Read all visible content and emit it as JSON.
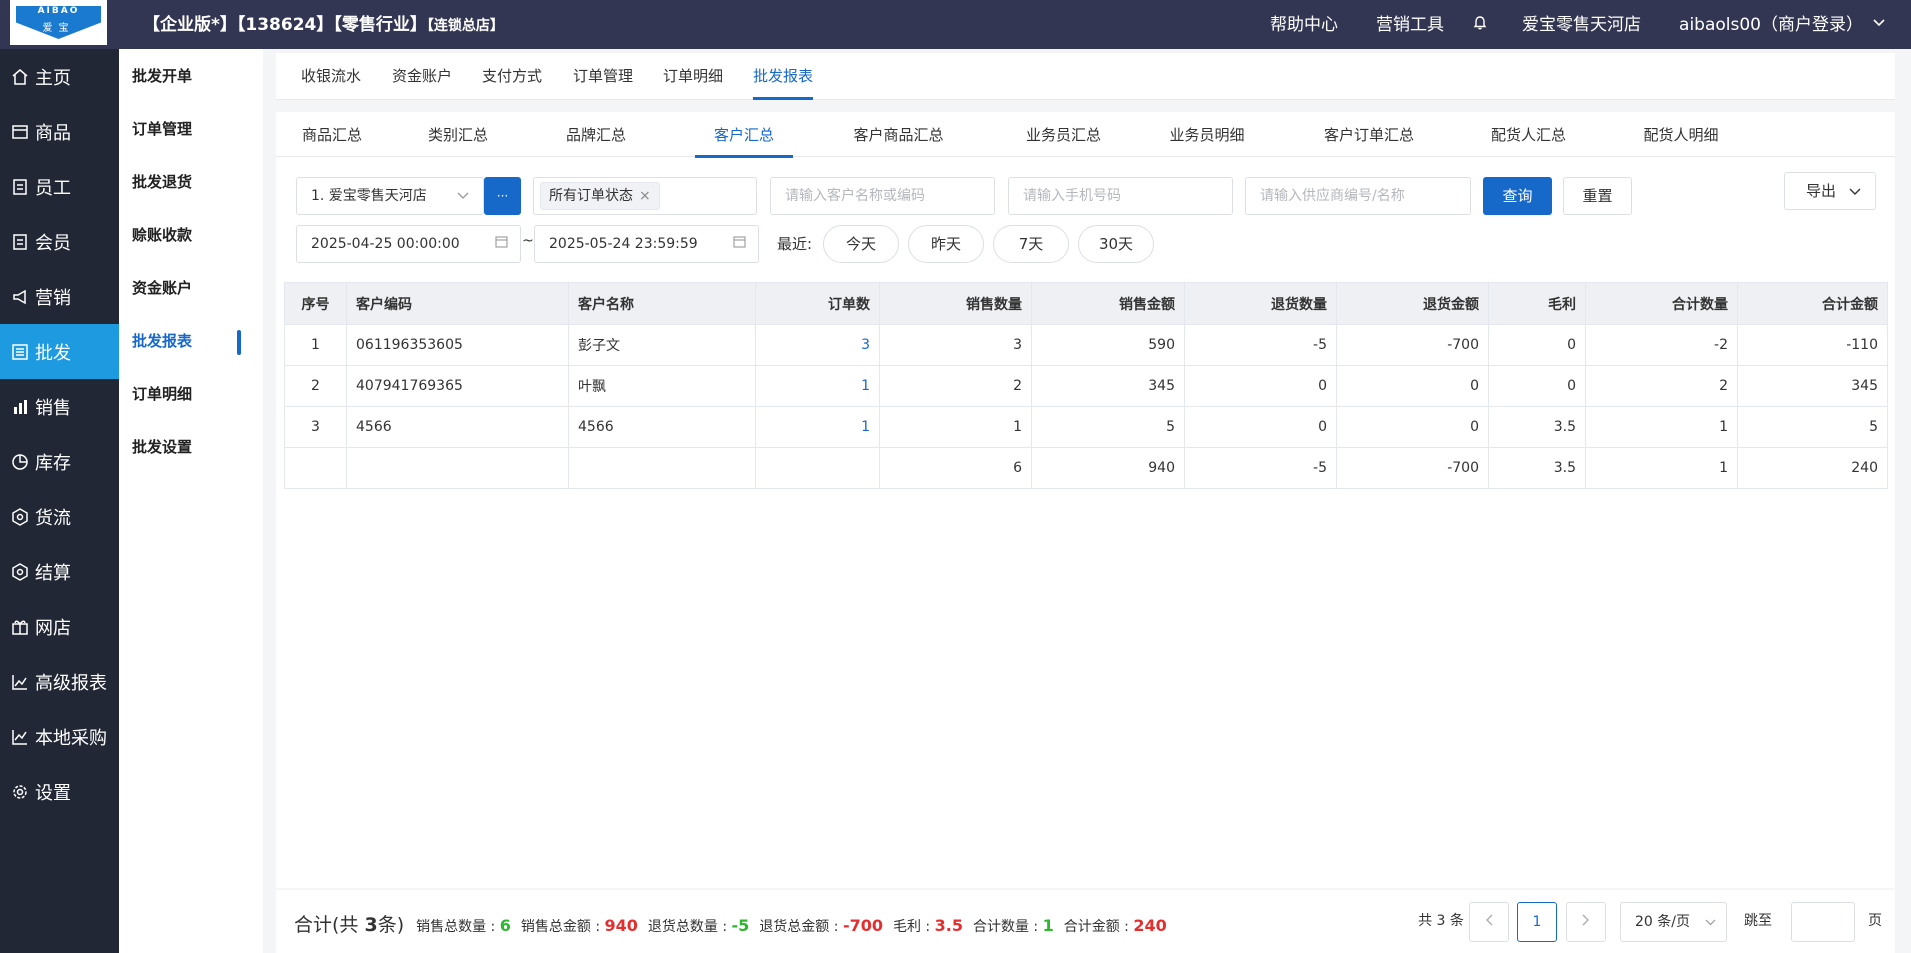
{
  "header": {
    "logo_top": "AIBAO",
    "logo_bottom": "爱宝",
    "title": "【企业版*】【138624】【零售行业】",
    "title_small": "【连锁总店】",
    "help": "帮助中心",
    "marketing": "营销工具",
    "store": "爱宝零售天河店",
    "user": "aibaols00（商户登录）"
  },
  "sidebar": {
    "items": [
      {
        "label": "主页",
        "icon": "home-icon"
      },
      {
        "label": "商品",
        "icon": "goods-icon"
      },
      {
        "label": "员工",
        "icon": "staff-icon"
      },
      {
        "label": "会员",
        "icon": "member-icon"
      },
      {
        "label": "营销",
        "icon": "megaphone-icon"
      },
      {
        "label": "批发",
        "icon": "wholesale-icon"
      },
      {
        "label": "销售",
        "icon": "bar-chart-icon"
      },
      {
        "label": "库存",
        "icon": "pie-chart-icon"
      },
      {
        "label": "货流",
        "icon": "logistics-icon"
      },
      {
        "label": "结算",
        "icon": "settlement-icon"
      },
      {
        "label": "网店",
        "icon": "gift-icon"
      },
      {
        "label": "高级报表",
        "icon": "line-chart-icon"
      },
      {
        "label": "本地采购",
        "icon": "trend-icon"
      },
      {
        "label": "设置",
        "icon": "gear-icon"
      }
    ],
    "active": "批发"
  },
  "subnav": {
    "items": [
      "批发开单",
      "订单管理",
      "批发退货",
      "赊账收款",
      "资金账户",
      "批发报表",
      "订单明细",
      "批发设置"
    ],
    "active": "批发报表"
  },
  "tabs_top": {
    "items": [
      "收银流水",
      "资金账户",
      "支付方式",
      "订单管理",
      "订单明细",
      "批发报表"
    ],
    "active": "批发报表"
  },
  "tabs_report": {
    "items": [
      "商品汇总",
      "类别汇总",
      "品牌汇总",
      "客户汇总",
      "客户商品汇总",
      "业务员汇总",
      "业务员明细",
      "客户订单汇总",
      "配货人汇总",
      "配货人明细"
    ],
    "active": "客户汇总"
  },
  "filters": {
    "store": "1. 爱宝零售天河店",
    "more_button": "···",
    "order_status": "所有订单状态",
    "customer_placeholder": "请输入客户名称或编码",
    "phone_placeholder": "请输入手机号码",
    "supplier_placeholder": "请输入供应商编号/名称",
    "query": "查询",
    "reset": "重置",
    "export": "导出",
    "date_start": "2025-04-25 00:00:00",
    "date_sep": "~",
    "date_end": "2025-05-24 23:59:59",
    "recent_label": "最近:",
    "recent": [
      "今天",
      "昨天",
      "7天",
      "30天"
    ]
  },
  "table": {
    "headers": [
      "序号",
      "客户编码",
      "客户名称",
      "订单数",
      "销售数量",
      "销售金额",
      "退货数量",
      "退货金额",
      "毛利",
      "合计数量",
      "合计金额"
    ],
    "rows": [
      [
        "1",
        "061196353605",
        "彭子文",
        "3",
        "3",
        "590",
        "-5",
        "-700",
        "0",
        "-2",
        "-110"
      ],
      [
        "2",
        "407941769365",
        "叶飘",
        "1",
        "2",
        "345",
        "0",
        "0",
        "0",
        "2",
        "345"
      ],
      [
        "3",
        "4566",
        "4566",
        "1",
        "1",
        "5",
        "0",
        "0",
        "3.5",
        "1",
        "5"
      ]
    ],
    "total": [
      "",
      "",
      "",
      "",
      "6",
      "940",
      "-5",
      "-700",
      "3.5",
      "1",
      "240"
    ]
  },
  "footer": {
    "total_prefix": "合计(共 ",
    "total_count": "3",
    "total_suffix": "条)",
    "sales_qty_label": "销售总数量 : ",
    "sales_qty": "6",
    "sales_amt_label": "销售总金额 : ",
    "sales_amt": "940",
    "ret_qty_label": "退货总数量 : ",
    "ret_qty": "-5",
    "ret_amt_label": "退货总金额 : ",
    "ret_amt": "-700",
    "profit_label": "毛利 : ",
    "profit": "3.5",
    "sum_qty_label": "合计数量 : ",
    "sum_qty": "1",
    "sum_amt_label": "合计金额 : ",
    "sum_amt": "240",
    "pager_total": "共 3 条",
    "page": "1",
    "page_size": "20 条/页",
    "jump_label": "跳至",
    "page_unit": "页"
  },
  "colors": {
    "topbar": "#333652",
    "sidebar": "#222736",
    "sidebar_active": "#1e9be0",
    "accent": "#1769c9",
    "green": "#2eb82e",
    "red": "#e62e2e"
  }
}
